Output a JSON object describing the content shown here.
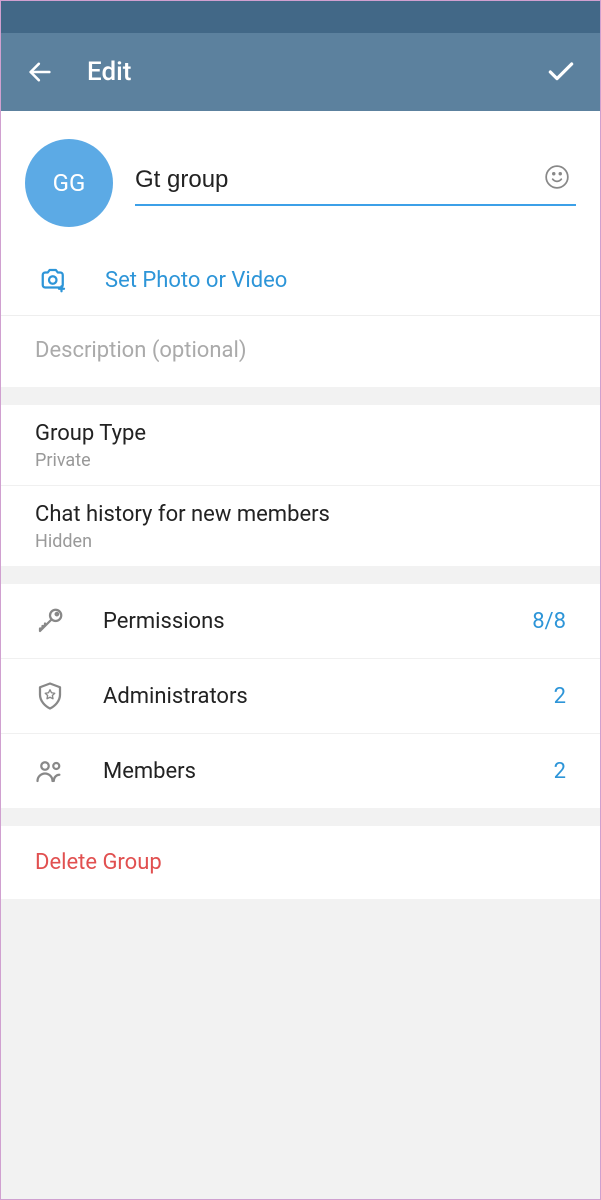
{
  "header": {
    "title": "Edit"
  },
  "avatar": {
    "initials": "GG"
  },
  "name_input": {
    "value": "Gt group"
  },
  "set_photo": {
    "label": "Set Photo or Video"
  },
  "description": {
    "placeholder": "Description (optional)"
  },
  "group_type": {
    "title": "Group Type",
    "value": "Private"
  },
  "chat_history": {
    "title": "Chat history for new members",
    "value": "Hidden"
  },
  "permissions": {
    "label": "Permissions",
    "count": "8/8"
  },
  "administrators": {
    "label": "Administrators",
    "count": "2"
  },
  "members": {
    "label": "Members",
    "count": "2"
  },
  "delete": {
    "label": "Delete Group"
  }
}
